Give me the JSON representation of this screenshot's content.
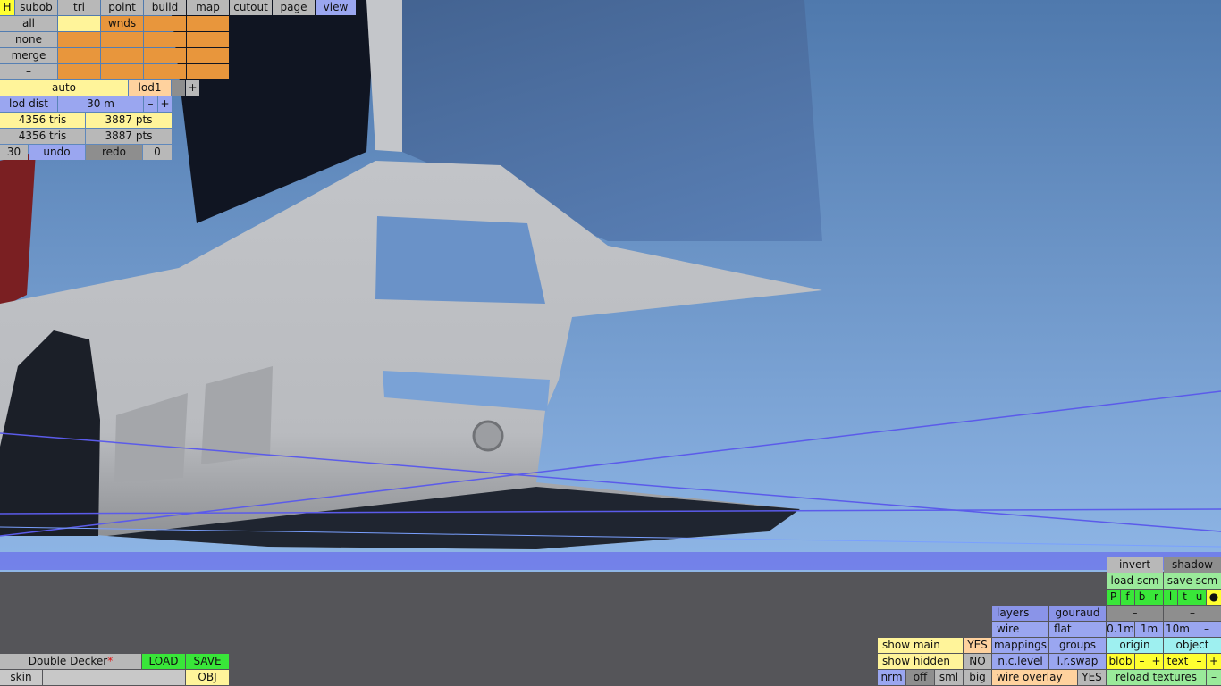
{
  "top_tabs": [
    "H",
    "subob",
    "tri",
    "point",
    "build",
    "map",
    "cutout",
    "page",
    "view"
  ],
  "sel_rows": [
    {
      "label": "all",
      "cells": [
        "",
        "wnds",
        "",
        ""
      ]
    },
    {
      "label": "none",
      "cells": [
        "",
        "",
        "",
        ""
      ]
    },
    {
      "label": "merge",
      "cells": [
        "",
        "",
        "",
        ""
      ]
    },
    {
      "label": "–",
      "cells": [
        "",
        "",
        "",
        ""
      ]
    }
  ],
  "lod": {
    "mode": "auto",
    "level": "lod1",
    "minus": "–",
    "plus": "+"
  },
  "lod_dist": {
    "label": "lod dist",
    "value": "30 m",
    "minus": "–",
    "plus": "+"
  },
  "stats": [
    {
      "tris": "4356 tris",
      "pts": "3887 pts"
    },
    {
      "tris": "4356 tris",
      "pts": "3887 pts"
    }
  ],
  "history": {
    "count": "30",
    "undo": "undo",
    "redo": "redo",
    "redo_count": "0"
  },
  "file": {
    "name": "Double Decker",
    "modified": "*",
    "load": "LOAD",
    "save": "SAVE",
    "skin": "skin",
    "skin_value": "",
    "obj": "OBJ"
  },
  "right_panel": {
    "invert": "invert",
    "shadow": "shadow",
    "load_scm": "load scm",
    "save_scm": "save scm",
    "view_letters": [
      "P",
      "f",
      "b",
      "r",
      "l",
      "t",
      "u",
      "●"
    ],
    "layers": "layers",
    "gouraud": "gouraud",
    "dash1": "–",
    "dash2": "–",
    "wire": "wire",
    "flat": "flat",
    "grid": [
      "0.1m",
      "1m",
      "10m",
      "–"
    ],
    "mappings": "mappings",
    "groups": "groups",
    "origin": "origin",
    "object": "object",
    "nclevel": "n.c.level",
    "lrswap": "l.r.swap",
    "blob": "blob",
    "blob_minus": "–",
    "blob_plus": "+",
    "text": "text",
    "text_minus": "–",
    "text_plus": "+",
    "reload": "reload textures",
    "reload_minus": "–"
  },
  "bottom_middle": {
    "show_main": "show main",
    "show_main_val": "YES",
    "show_hidden": "show hidden",
    "show_hidden_val": "NO",
    "nrm": "nrm",
    "off": "off",
    "sml": "sml",
    "big": "big",
    "wire_overlay": "wire overlay",
    "wire_overlay_val": "YES"
  }
}
